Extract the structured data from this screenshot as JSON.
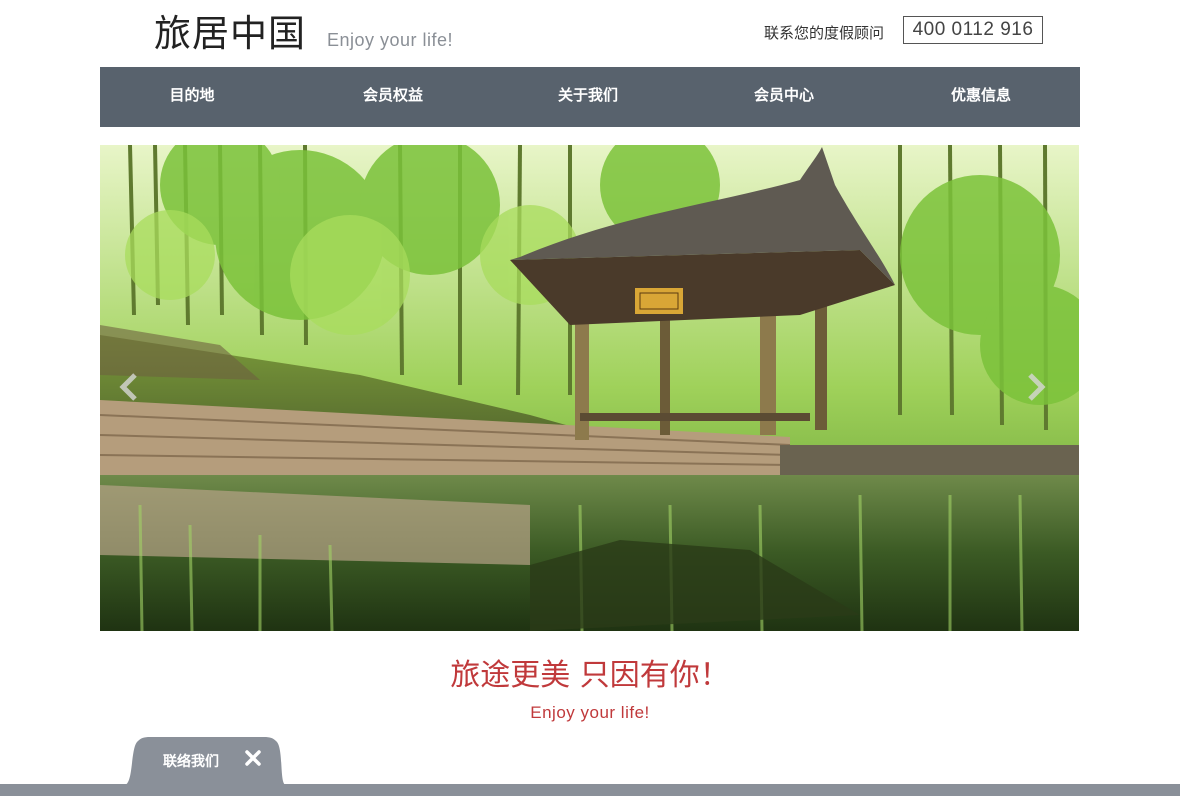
{
  "header": {
    "logo": "旅居中国",
    "logo_tagline": "Enjoy your life!",
    "contact_label": "联系您的度假顾问",
    "phone": "400 0112 916"
  },
  "nav": {
    "items": [
      {
        "label": "目的地"
      },
      {
        "label": "会员权益"
      },
      {
        "label": "关于我们"
      },
      {
        "label": "会员中心"
      },
      {
        "label": "优惠信息"
      }
    ]
  },
  "hero": {
    "image": "bamboo-forest-pavilion-reflection",
    "prev_icon": "chevron-left-icon",
    "next_icon": "chevron-right-icon"
  },
  "main": {
    "tagline": "旅途更美 只因有你！",
    "tagline_sub": "Enjoy your life!"
  },
  "contact_widget": {
    "label": "联络我们",
    "close_icon": "close-icon"
  },
  "colors": {
    "nav_bg": "#58626d",
    "accent_red": "#c0393b",
    "footer_bar": "#8a9099"
  }
}
